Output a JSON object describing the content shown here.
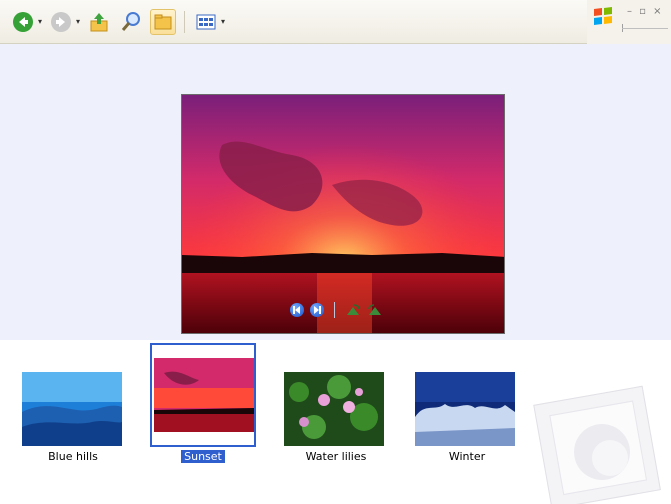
{
  "toolbar": {
    "buttons": [
      {
        "name": "back",
        "icon": "back-arrow-icon"
      },
      {
        "name": "forward",
        "icon": "forward-arrow-icon"
      },
      {
        "name": "up",
        "icon": "up-folder-icon"
      },
      {
        "name": "search",
        "icon": "search-icon"
      },
      {
        "name": "folders",
        "icon": "folders-icon"
      },
      {
        "name": "views",
        "icon": "views-icon"
      }
    ]
  },
  "window_controls": "– ▫ ×",
  "viewer": {
    "controls": [
      "previous-image-icon",
      "next-image-icon",
      "rotate-clockwise-icon",
      "rotate-counterclockwise-icon"
    ]
  },
  "thumbnails": [
    {
      "label": "Blue hills",
      "selected": false
    },
    {
      "label": "Sunset",
      "selected": true
    },
    {
      "label": "Water lilies",
      "selected": false
    },
    {
      "label": "Winter",
      "selected": false
    }
  ],
  "colors": {
    "selection": "#2f5fcf",
    "viewer_bg": "#eef0fb",
    "toolbar_bg": "#efece2"
  }
}
